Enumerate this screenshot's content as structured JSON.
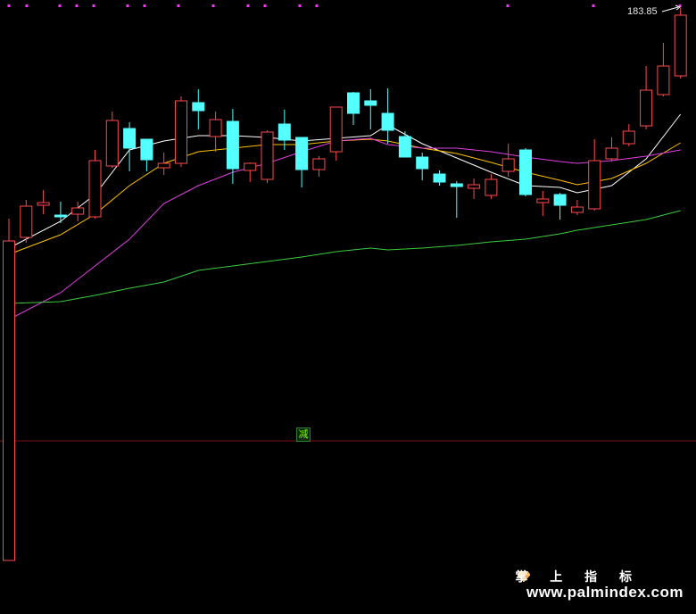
{
  "price_label": "183.85",
  "marker_label": "减",
  "watermark": {
    "chinese": "掌 上 指 标",
    "url": "www.palmindex.com"
  },
  "colors": {
    "background": "#000000",
    "up_candle": "#ff4a4a",
    "down_candle": "#54ffff",
    "ma_fast": "#ffffff",
    "ma_mid": "#ffc000",
    "ma_slow": "#e040e0",
    "ma_long": "#3ccc3c",
    "divider": "#7a1010",
    "top_dots": "#ff33ff"
  },
  "chart_data": {
    "type": "candlestick",
    "y_unit": "price",
    "ylim": [
      0,
      688
    ],
    "candles": [
      {
        "x": 0,
        "o": 60,
        "h": 443,
        "l": 405,
        "c": 418
      },
      {
        "x": 1,
        "o": 422,
        "h": 464,
        "l": 416,
        "c": 457
      },
      {
        "x": 2,
        "o": 458,
        "h": 475,
        "l": 448,
        "c": 461
      },
      {
        "x": 3,
        "o": 447,
        "h": 462,
        "l": 438,
        "c": 445
      },
      {
        "x": 4,
        "o": 448,
        "h": 462,
        "l": 440,
        "c": 455
      },
      {
        "x": 5,
        "o": 445,
        "h": 520,
        "l": 443,
        "c": 508
      },
      {
        "x": 6,
        "o": 502,
        "h": 563,
        "l": 500,
        "c": 553
      },
      {
        "x": 7,
        "o": 544,
        "h": 551,
        "l": 496,
        "c": 522
      },
      {
        "x": 8,
        "o": 532,
        "h": 520,
        "l": 496,
        "c": 509
      },
      {
        "x": 9,
        "o": 500,
        "h": 517,
        "l": 492,
        "c": 505
      },
      {
        "x": 10,
        "o": 505,
        "h": 580,
        "l": 501,
        "c": 575
      },
      {
        "x": 11,
        "o": 573,
        "h": 588,
        "l": 543,
        "c": 564
      },
      {
        "x": 12,
        "o": 535,
        "h": 563,
        "l": 518,
        "c": 554
      },
      {
        "x": 13,
        "o": 552,
        "h": 566,
        "l": 482,
        "c": 499
      },
      {
        "x": 14,
        "o": 497,
        "h": 506,
        "l": 484,
        "c": 505
      },
      {
        "x": 15,
        "o": 487,
        "h": 542,
        "l": 483,
        "c": 540
      },
      {
        "x": 16,
        "o": 549,
        "h": 565,
        "l": 520,
        "c": 531
      },
      {
        "x": 17,
        "o": 534,
        "h": 534,
        "l": 478,
        "c": 498
      },
      {
        "x": 18,
        "o": 498,
        "h": 513,
        "l": 490,
        "c": 510
      },
      {
        "x": 19,
        "o": 518,
        "h": 567,
        "l": 508,
        "c": 568
      },
      {
        "x": 20,
        "o": 584,
        "h": 585,
        "l": 548,
        "c": 561
      },
      {
        "x": 21,
        "o": 575,
        "h": 588,
        "l": 543,
        "c": 570
      },
      {
        "x": 22,
        "o": 561,
        "h": 589,
        "l": 527,
        "c": 542
      },
      {
        "x": 23,
        "o": 535,
        "h": 541,
        "l": 512,
        "c": 512
      },
      {
        "x": 24,
        "o": 512,
        "h": 517,
        "l": 486,
        "c": 499
      },
      {
        "x": 25,
        "o": 493,
        "h": 497,
        "l": 480,
        "c": 484
      },
      {
        "x": 26,
        "o": 482,
        "h": 485,
        "l": 444,
        "c": 479
      },
      {
        "x": 27,
        "o": 477,
        "h": 488,
        "l": 465,
        "c": 481
      },
      {
        "x": 28,
        "o": 469,
        "h": 493,
        "l": 465,
        "c": 487
      },
      {
        "x": 29,
        "o": 496,
        "h": 527,
        "l": 490,
        "c": 510
      },
      {
        "x": 30,
        "o": 520,
        "h": 522,
        "l": 468,
        "c": 470
      },
      {
        "x": 31,
        "o": 461,
        "h": 474,
        "l": 446,
        "c": 465
      },
      {
        "x": 32,
        "o": 470,
        "h": 472,
        "l": 442,
        "c": 458
      },
      {
        "x": 33,
        "o": 450,
        "h": 464,
        "l": 447,
        "c": 456
      },
      {
        "x": 34,
        "o": 454,
        "h": 532,
        "l": 452,
        "c": 508
      },
      {
        "x": 35,
        "o": 510,
        "h": 534,
        "l": 507,
        "c": 522
      },
      {
        "x": 36,
        "o": 527,
        "h": 549,
        "l": 524,
        "c": 541
      },
      {
        "x": 37,
        "o": 547,
        "h": 614,
        "l": 543,
        "c": 587
      },
      {
        "x": 38,
        "o": 582,
        "h": 640,
        "l": 580,
        "c": 614
      },
      {
        "x": 39,
        "o": 603,
        "h": 679,
        "l": 600,
        "c": 671
      }
    ],
    "ma_lines": [
      {
        "points": [
          [
            0,
            410
          ],
          [
            3,
            440
          ],
          [
            5,
            470
          ],
          [
            7,
            520
          ],
          [
            9,
            530
          ],
          [
            11,
            536
          ],
          [
            13,
            536
          ],
          [
            15,
            534
          ],
          [
            17,
            530
          ],
          [
            19,
            533
          ],
          [
            21,
            536
          ],
          [
            22,
            548
          ],
          [
            24,
            527
          ],
          [
            26,
            511
          ],
          [
            28,
            495
          ],
          [
            30,
            480
          ],
          [
            32,
            478
          ],
          [
            33,
            472
          ],
          [
            35,
            480
          ],
          [
            37,
            510
          ],
          [
            39,
            560
          ]
        ]
      },
      {
        "points": [
          [
            0,
            403
          ],
          [
            3,
            425
          ],
          [
            5,
            448
          ],
          [
            7,
            480
          ],
          [
            9,
            505
          ],
          [
            11,
            518
          ],
          [
            13,
            522
          ],
          [
            15,
            526
          ],
          [
            17,
            526
          ],
          [
            19,
            530
          ],
          [
            21,
            532
          ],
          [
            22,
            530
          ],
          [
            24,
            522
          ],
          [
            26,
            516
          ],
          [
            28,
            506
          ],
          [
            30,
            495
          ],
          [
            32,
            486
          ],
          [
            33,
            481
          ],
          [
            35,
            488
          ],
          [
            37,
            505
          ],
          [
            39,
            528
          ]
        ]
      },
      {
        "points": [
          [
            0,
            330
          ],
          [
            3,
            360
          ],
          [
            5,
            390
          ],
          [
            7,
            420
          ],
          [
            9,
            460
          ],
          [
            11,
            480
          ],
          [
            13,
            495
          ],
          [
            15,
            505
          ],
          [
            17,
            518
          ],
          [
            19,
            530
          ],
          [
            21,
            533
          ],
          [
            22,
            526
          ],
          [
            24,
            522
          ],
          [
            26,
            522
          ],
          [
            28,
            518
          ],
          [
            30,
            512
          ],
          [
            32,
            507
          ],
          [
            33,
            505
          ],
          [
            35,
            508
          ],
          [
            37,
            513
          ],
          [
            39,
            520
          ]
        ]
      },
      {
        "points": [
          [
            0,
            348
          ],
          [
            3,
            350
          ],
          [
            5,
            357
          ],
          [
            7,
            365
          ],
          [
            9,
            372
          ],
          [
            11,
            385
          ],
          [
            13,
            390
          ],
          [
            15,
            395
          ],
          [
            17,
            400
          ],
          [
            19,
            406
          ],
          [
            21,
            410
          ],
          [
            22,
            408
          ],
          [
            24,
            410
          ],
          [
            26,
            413
          ],
          [
            28,
            417
          ],
          [
            30,
            420
          ],
          [
            32,
            426
          ],
          [
            33,
            430
          ],
          [
            35,
            436
          ],
          [
            37,
            442
          ],
          [
            39,
            452
          ]
        ]
      }
    ]
  }
}
